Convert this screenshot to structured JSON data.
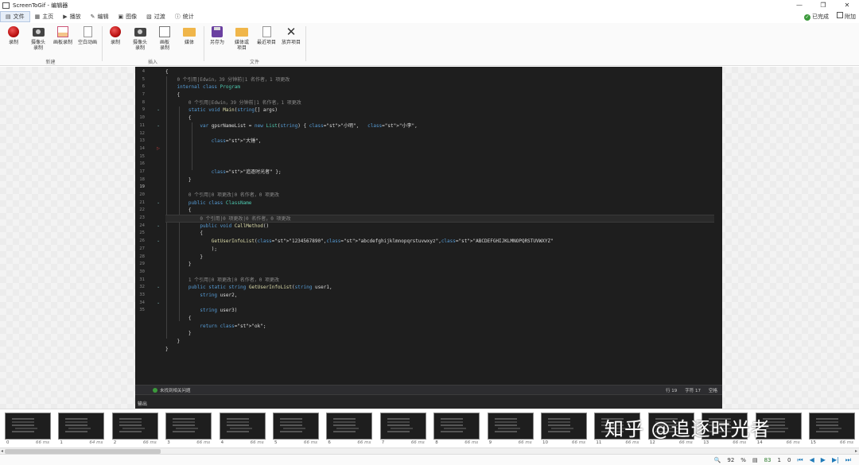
{
  "window": {
    "app_name": "ScreenToGif",
    "title": "ScreenToGif - 编辑器",
    "controls": [
      "—",
      "❐",
      "✕"
    ]
  },
  "tabs": [
    {
      "label": "文件",
      "icon": "file-icon",
      "active": true
    },
    {
      "label": "主页",
      "icon": "home-icon"
    },
    {
      "label": "播放",
      "icon": "play-icon"
    },
    {
      "label": "编辑",
      "icon": "edit-icon"
    },
    {
      "label": "图像",
      "icon": "image-icon"
    },
    {
      "label": "过渡",
      "icon": "transition-icon"
    },
    {
      "label": "统计",
      "icon": "info-icon"
    }
  ],
  "status_right": {
    "done": "已完成",
    "extra": "附加"
  },
  "ribbon": {
    "new_group": {
      "label": "新建",
      "buttons": [
        "录制",
        "摄像头\n录制",
        "画板录制",
        "空白动画"
      ]
    },
    "insert_group": {
      "label": "插入",
      "buttons": [
        "录制",
        "摄像头\n录制",
        "画板\n录制",
        "媒体"
      ]
    },
    "file_group": {
      "label": "文件",
      "buttons": [
        "另存为",
        "媒体或\n项目",
        "最近项目",
        "放弃项目"
      ]
    }
  },
  "editor": {
    "line_numbers": [
      "4",
      "5",
      "6",
      "7",
      "8",
      "9",
      "10",
      "11",
      "12",
      "13",
      "14",
      "15",
      "16",
      "17",
      "18",
      "19",
      "20",
      "21",
      "22",
      "23",
      "24",
      "25",
      "26",
      "27",
      "28",
      "29",
      "30",
      "31",
      "32",
      "33",
      "34",
      "35"
    ],
    "code_lines": [
      "{",
      "    0 个引用|Edwin，39 分钟前|1 名作者，1 项更改",
      "    internal class Program",
      "    {",
      "        0 个引用|Edwin，39 分钟前|1 名作者，1 项更改",
      "        static void Main(string[] args)",
      "        {",
      "            var gpsrNameList = new List(string) { \"小明\",   \"小李\",",
      "",
      "                \"大锤\",",
      "",
      "",
      "",
      "                \"追逐时光者\" };",
      "        }",
      "",
      "        0 个引用|0 项更改|0 名作者，0 项更改",
      "        public class ClassName",
      "        {",
      "            0 个引用|0 项更改|0 名作者，0 项更改",
      "            public void CallMethod()",
      "            {",
      "                GetUserInfoList(\"1234567890\",\"abcdefghijklmnopqrstuvwxyz\",\"ABCDEFGHIJKLMNOPQRSTUVWXYZ\"",
      "                );",
      "            }",
      "        }",
      "",
      "        1 个引用|0 项更改|0 名作者，0 项更改",
      "        public static string GetUserInfoList(string user1,",
      "            string user2,",
      "",
      "            string user3)",
      "        {",
      "            return \"ok\";",
      "        }",
      "    }",
      "}",
      ""
    ],
    "status": {
      "issues": "未找到相关问题",
      "line": "行 19",
      "col": "字符 17",
      "mode": "空格"
    },
    "output_label": "输出"
  },
  "timeline": {
    "frames": [
      {
        "index": "0",
        "duration": "66 ms"
      },
      {
        "index": "1",
        "duration": "64 ms"
      },
      {
        "index": "2",
        "duration": "66 ms"
      },
      {
        "index": "3",
        "duration": "66 ms"
      },
      {
        "index": "4",
        "duration": "66 ms"
      },
      {
        "index": "5",
        "duration": "66 ms"
      },
      {
        "index": "6",
        "duration": "66 ms"
      },
      {
        "index": "7",
        "duration": "66 ms"
      },
      {
        "index": "8",
        "duration": "66 ms"
      },
      {
        "index": "9",
        "duration": "66 ms"
      },
      {
        "index": "10",
        "duration": "66 ms"
      },
      {
        "index": "11",
        "duration": "66 ms"
      },
      {
        "index": "12",
        "duration": "66 ms"
      },
      {
        "index": "13",
        "duration": "66 ms"
      },
      {
        "index": "14",
        "duration": "66 ms"
      },
      {
        "index": "15",
        "duration": "66 ms"
      }
    ]
  },
  "watermark": "知乎 @追逐时光者",
  "bottom": {
    "zoom": "92",
    "percent": "%",
    "frame_pos": "83",
    "sel_count": "1",
    "total": "0"
  }
}
